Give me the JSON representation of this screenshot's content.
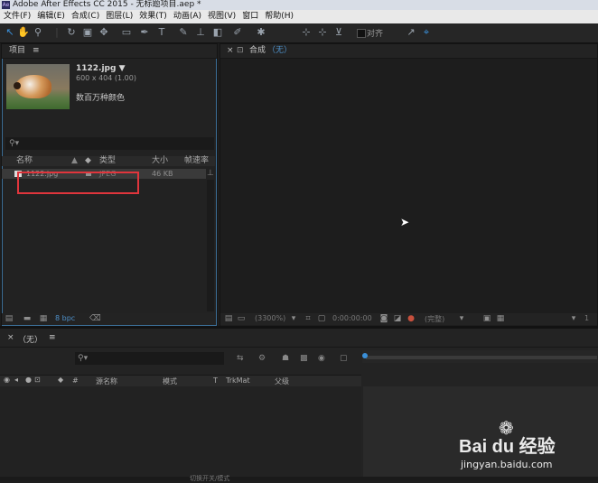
{
  "app": {
    "window_title": "Adobe After Effects CC 2015 - 无标题项目.aep *",
    "ae_badge": "Ae"
  },
  "menu": [
    "文件(F)",
    "编辑(E)",
    "合成(C)",
    "图层(L)",
    "效果(T)",
    "动画(A)",
    "视图(V)",
    "窗口",
    "帮助(H)"
  ],
  "toolbar": {
    "snap_label": "对齐"
  },
  "project": {
    "tab_label": "项目",
    "menu_icon": "≡",
    "preview": {
      "filename": "1122.jpg ▼",
      "dimensions": "600 x 404 (1.00)",
      "color_info": "数百万种颜色"
    },
    "search_icon": "⚲▾",
    "columns": {
      "name": "名称",
      "type": "类型",
      "size": "大小",
      "fps": "帧速率"
    },
    "rows": [
      {
        "name": "1122.jpg",
        "type": "JPEG",
        "size": "46 KB"
      }
    ],
    "bpc_label": "8 bpc"
  },
  "composition": {
    "tab_label": "合成",
    "tab_value": "（无）",
    "zoom": "(3300%)",
    "timecode": "0:00:00:00",
    "quality": "(完整)"
  },
  "timeline": {
    "tab_value": "（无）",
    "columns": {
      "hash": "#",
      "source_name": "源名称",
      "mode": "模式",
      "t": "T",
      "trkmat": "TrkMat",
      "parent": "父级"
    },
    "bottom_label": "切换开关/模式"
  },
  "watermark": {
    "brand": "Bai du 经验",
    "url": "jingyan.baidu.com"
  }
}
